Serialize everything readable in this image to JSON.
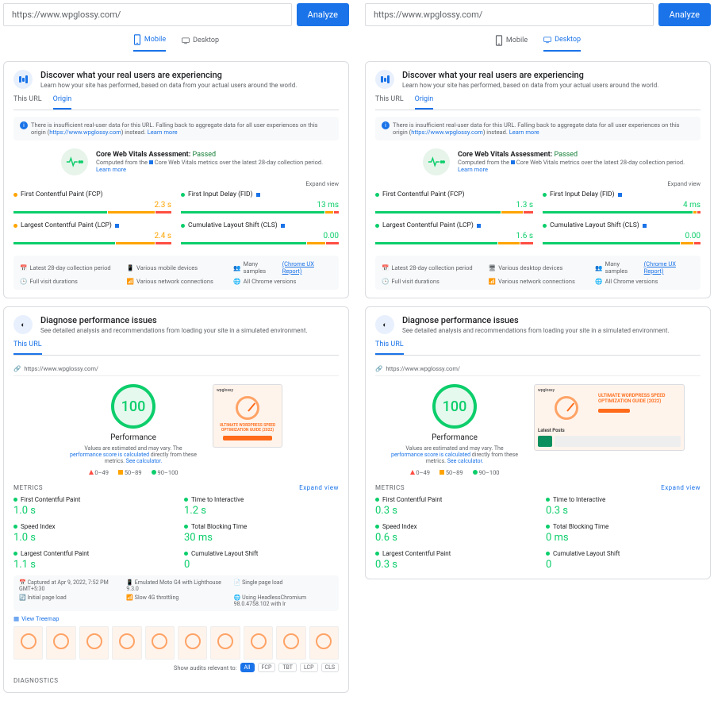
{
  "url": "https://www.wpglossy.com/",
  "analyze": "Analyze",
  "tabs": {
    "mobile": "Mobile",
    "desktop": "Desktop"
  },
  "discover": {
    "title": "Discover what your real users are experiencing",
    "sub": "Learn how your site has performed, based on data from your actual users around the world."
  },
  "subtabs": {
    "thisurl": "This URL",
    "origin": "Origin"
  },
  "info": {
    "pre": "There is insufficient real-user data for this URL. Falling back to aggregate data for all user experiences on this origin (",
    "link": "https://www.wpglossy.com",
    "post": ") instead.",
    "learn": "Learn more"
  },
  "assessment": {
    "label": "Core Web Vitals Assessment:",
    "status": "Passed",
    "s1": "Computed from the ",
    "s1b": "Core Web Vitals",
    "s1c": " metrics over the latest 28-day collection period.",
    "learn": "Learn more"
  },
  "expand": "Expand view",
  "mobile_metrics": {
    "fcp": {
      "name": "First Contentful Paint (FCP)",
      "val": "2.3 s",
      "color": "o"
    },
    "fid": {
      "name": "First Input Delay (FID)",
      "val": "13 ms",
      "color": "g"
    },
    "lcp": {
      "name": "Largest Contentful Paint (LCP)",
      "val": "2.4 s",
      "color": "o"
    },
    "cls": {
      "name": "Cumulative Layout Shift (CLS)",
      "val": "0.00",
      "color": "g"
    }
  },
  "desktop_metrics": {
    "fcp": {
      "name": "First Contentful Paint (FCP)",
      "val": "1.3 s",
      "color": "g"
    },
    "fid": {
      "name": "First Input Delay (FID)",
      "val": "4 ms",
      "color": "g"
    },
    "lcp": {
      "name": "Largest Contentful Paint (LCP)",
      "val": "1.6 s",
      "color": "g"
    },
    "cls": {
      "name": "Cumulative Layout Shift (CLS)",
      "val": "0.00",
      "color": "g"
    }
  },
  "foot": {
    "period": "Latest 28-day collection period",
    "devices_m": "Various mobile devices",
    "devices_d": "Various desktop devices",
    "samples": "Many samples",
    "samples_link": "(Chrome UX Report)",
    "visit": "Full visit durations",
    "net": "Various network connections",
    "chrome": "All Chrome versions"
  },
  "diagnose": {
    "title": "Diagnose performance issues",
    "sub": "See detailed analysis and recommendations from loading your site in a simulated environment."
  },
  "perf": {
    "score": "100",
    "label": "Performance",
    "note1": "Values are estimated and may vary. The ",
    "note_link": "performance score is calculated",
    "note2": " directly from these metrics. ",
    "calc": "See calculator."
  },
  "thumb_title": "ULTIMATE WORDPRESS SPEED OPTIMIZATION GUIDE (2022)",
  "thumb_brand": "wpglossy",
  "legend": {
    "r": "0–49",
    "o": "50–89",
    "g": "90–100"
  },
  "metrics_hdr": "METRICS",
  "lab_m": {
    "fcp": {
      "name": "First Contentful Paint",
      "val": "1.0 s"
    },
    "tti": {
      "name": "Time to Interactive",
      "val": "1.2 s"
    },
    "si": {
      "name": "Speed Index",
      "val": "1.0 s"
    },
    "tbt": {
      "name": "Total Blocking Time",
      "val": "30 ms"
    },
    "lcp": {
      "name": "Largest Contentful Paint",
      "val": "1.1 s"
    },
    "cls": {
      "name": "Cumulative Layout Shift",
      "val": "0"
    }
  },
  "lab_d": {
    "fcp": {
      "name": "First Contentful Paint",
      "val": "0.3 s"
    },
    "tti": {
      "name": "Time to Interactive",
      "val": "0.3 s"
    },
    "si": {
      "name": "Speed Index",
      "val": "0.6 s"
    },
    "tbt": {
      "name": "Total Blocking Time",
      "val": "0 ms"
    },
    "lcp": {
      "name": "Largest Contentful Paint",
      "val": "0.3 s"
    },
    "cls": {
      "name": "Cumulative Layout Shift",
      "val": "0"
    }
  },
  "cap": {
    "time": "Captured at Apr 9, 2022, 7:52 PM GMT+5:30",
    "device": "Emulated Moto G4 with Lighthouse 9.3.0",
    "single": "Single page load",
    "initial": "Initial page load",
    "throttle": "Slow 4G throttling",
    "headless": "Using HeadlessChromium 98.0.4758.102 with lr"
  },
  "treemap": "View Treemap",
  "audits_label": "Show audits relevant to:",
  "pills": [
    "All",
    "FCP",
    "TBT",
    "LCP",
    "CLS"
  ],
  "diagnostics": "DIAGNOSTICS",
  "latest_posts": "Latest Posts"
}
